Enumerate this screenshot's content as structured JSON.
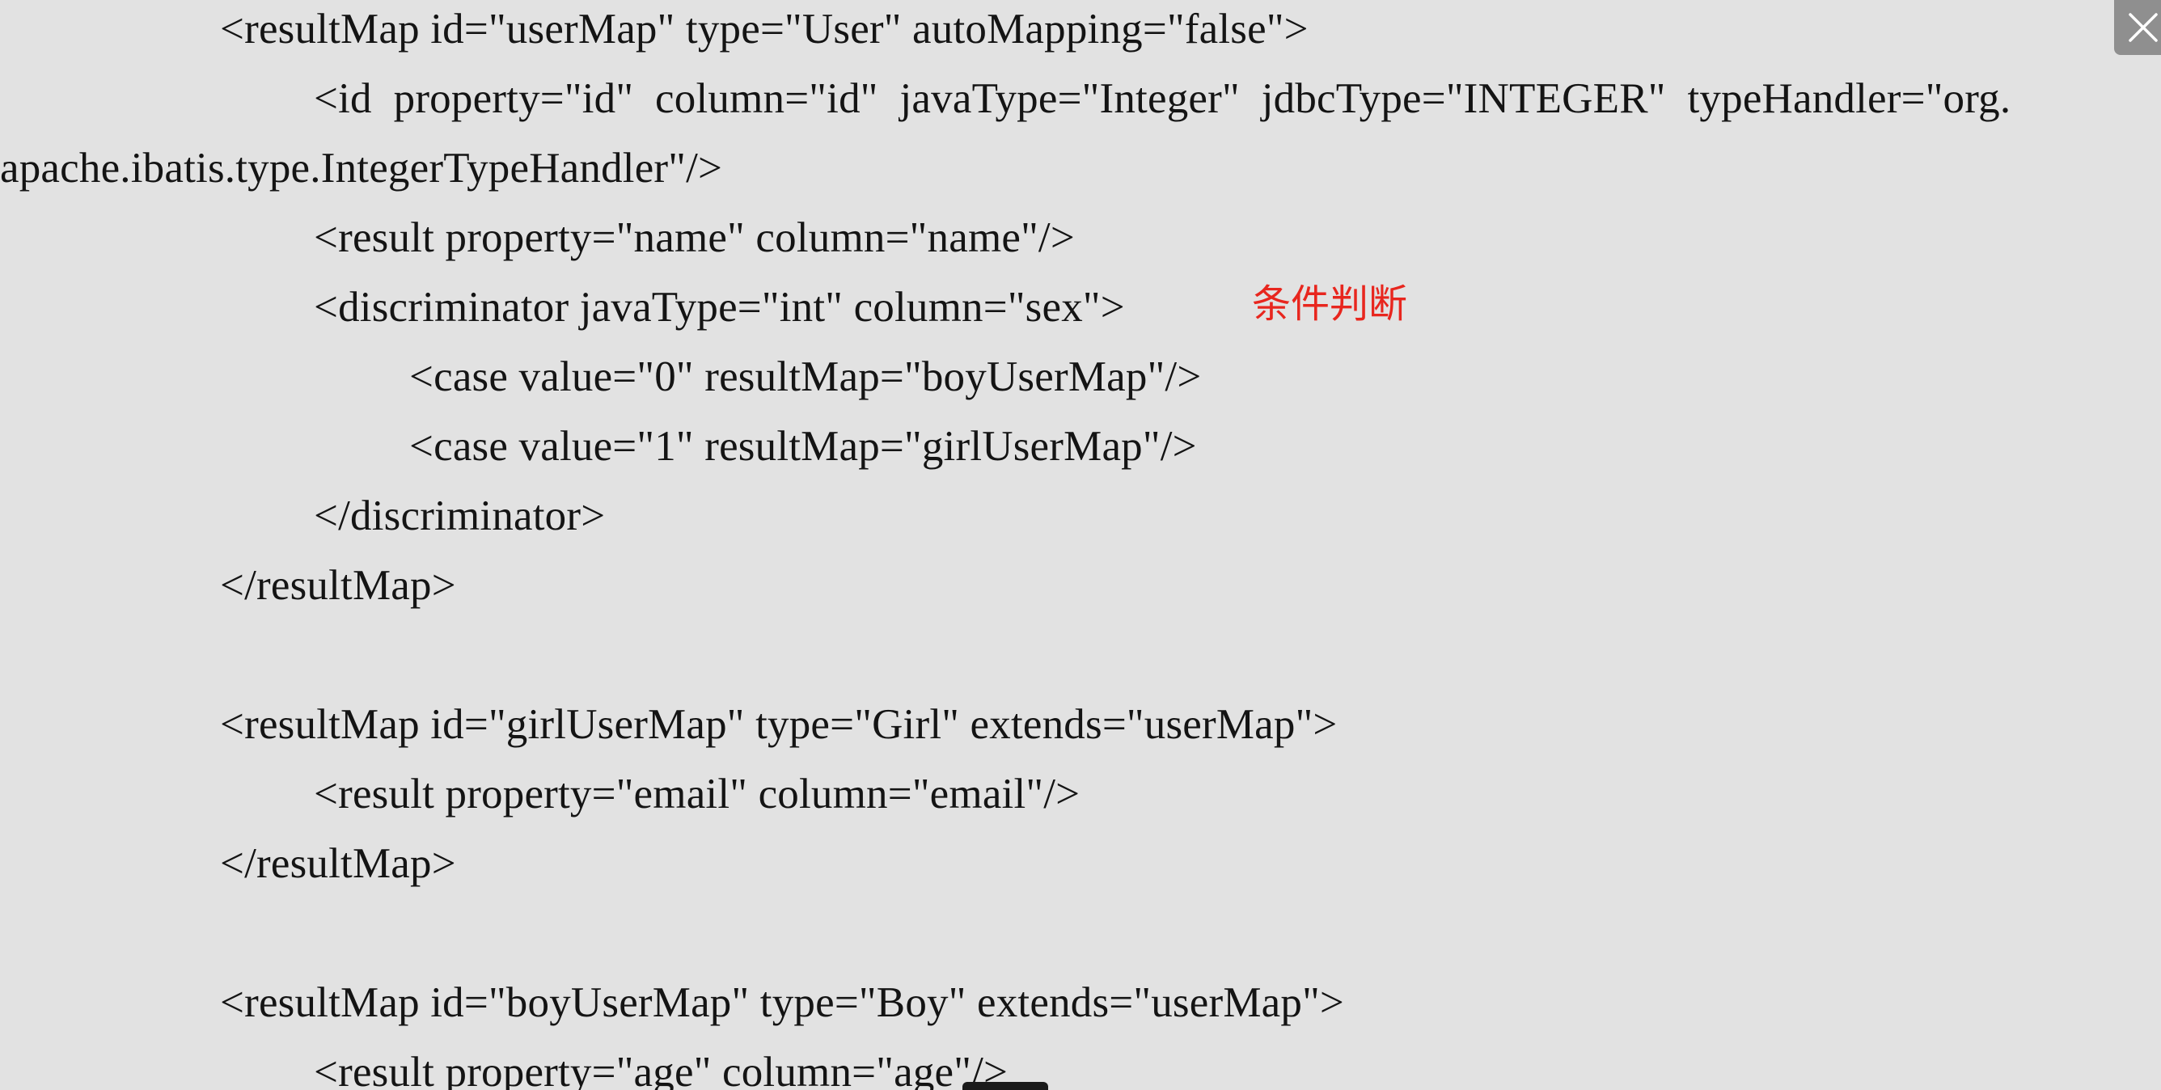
{
  "code_lines": [
    "<resultMap id=\"userMap\" type=\"User\" autoMapping=\"false\">",
    "<id  property=\"id\"  column=\"id\"  javaType=\"Integer\"  jdbcType=\"INTEGER\"  typeHandler=\"org.",
    "apache.ibatis.type.IntegerTypeHandler\"/>",
    "<result property=\"name\" column=\"name\"/>",
    "<discriminator javaType=\"int\" column=\"sex\">",
    "<case value=\"0\" resultMap=\"boyUserMap\"/>",
    "<case value=\"1\" resultMap=\"girlUserMap\"/>",
    "</discriminator>",
    "</resultMap>",
    "<resultMap id=\"girlUserMap\" type=\"Girl\" extends=\"userMap\">",
    "<result property=\"email\" column=\"email\"/>",
    "</resultMap>",
    "<resultMap id=\"boyUserMap\" type=\"Boy\" extends=\"userMap\">",
    "<result property=\"age\" column=\"age\"/>"
  ],
  "annotation": {
    "text": "条件判断",
    "color": "#e8261e"
  },
  "close_button": {
    "icon": "close-icon",
    "color": "#ffffff"
  },
  "colors": {
    "background": "#e2e2e2",
    "text": "#141414"
  }
}
